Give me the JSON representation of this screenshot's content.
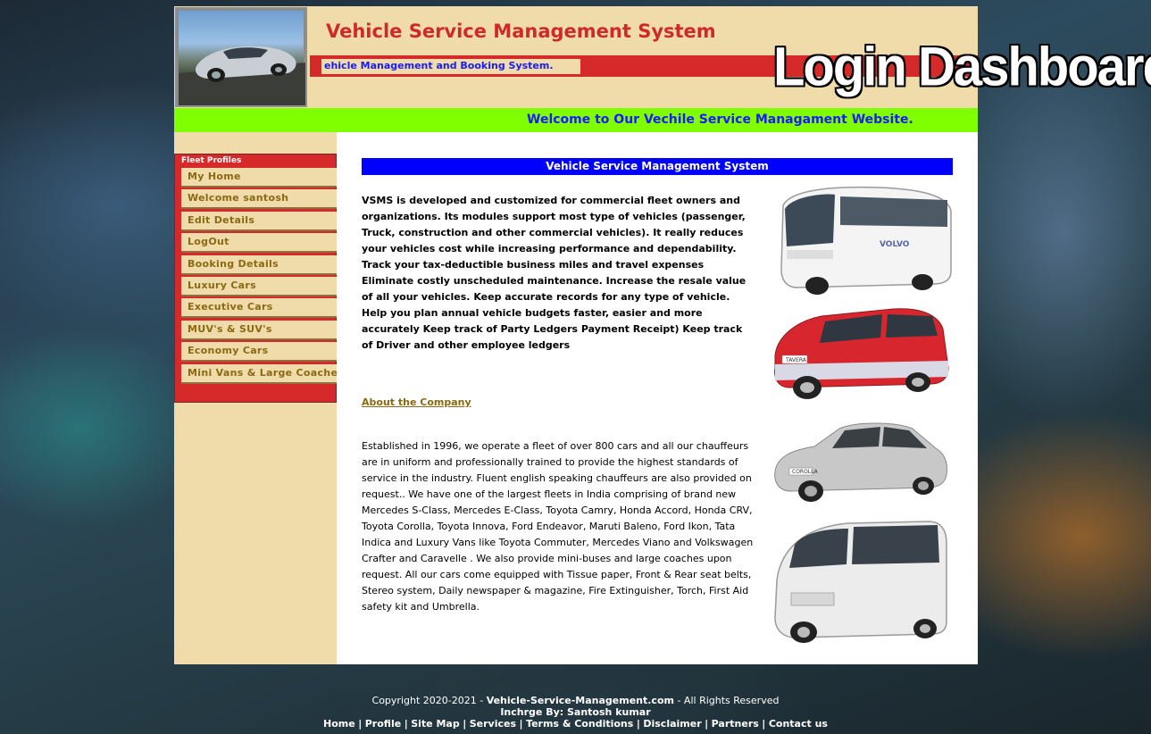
{
  "header": {
    "site_title": "Vehicle Service Management System",
    "tagline": "ehicle Management and Booking System.",
    "page_banner": "Login Dashboard",
    "welcome": "Welcome to Our Vechile Service Managament Website."
  },
  "sidebar": {
    "title": "Fleet Profiles",
    "items": [
      {
        "label": "My Home"
      },
      {
        "label": "Welcome santosh"
      },
      {
        "label": "Edit Details"
      },
      {
        "label": "LogOut"
      },
      {
        "label": "Booking Details"
      },
      {
        "label": "Luxury Cars"
      },
      {
        "label": "Executive Cars"
      },
      {
        "label": "MUV's & SUV's"
      },
      {
        "label": "Economy Cars"
      },
      {
        "label": "Mini Vans & Large Coaches"
      }
    ]
  },
  "main": {
    "section_title": "Vehicle Service Management System",
    "intro": "VSMS is developed and customized for commercial fleet owners and organizations. Its modules support most type of vehicles (passenger, Truck, construction and other commercial vehicles). It really reduces your vehicles cost while increasing performance and dependability. Track your tax-deductible business miles and travel expenses  Eliminate costly unscheduled maintenance.  Increase the resale value of all your vehicles.  Keep accurate records for any type of vehicle.  Help you plan annual vehicle budgets faster, easier and more accurately  Keep track of Party Ledgers Payment Receipt)  Keep track of Driver and other employee ledgers",
    "about_link": "About the Company",
    "company_text": "Established in 1996, we operate a fleet of over 800 cars and all our chauffeurs are in uniform and professionally trained to provide the highest standards of service in the industry. Fluent english speaking chauffeurs are also provided on request.. We have one of the largest fleets in India comprising of brand new Mercedes S-Class, Mercedes E-Class, Toyota Camry, Honda Accord, Honda CRV, Toyota Corolla, Toyota Innova, Ford Endeavor, Maruti Baleno, Ford Ikon, Tata Indica and Luxury Vans like Toyota Commuter, Mercedes Viano and Volkswagen Crafter and Caravelle . We also provide mini-buses and large coaches upon request. All our cars come equipped with Tissue paper, Front & Rear seat belts, Stereo system, Daily newspaper & magazine, Fire Extinguisher, Torch, First Aid safety kit and Umbrella.",
    "bus_label": "VOLVO",
    "suv_label": "TAVERA",
    "car_label": "COROLLA"
  },
  "footer": {
    "copyright_prefix": "Copyright 2020-2021 - ",
    "copyright_site": "Vehicle-Service-Management.com",
    "copyright_suffix": " - All Rights Reserved",
    "incharge": "Inchrge By: Santosh kumar",
    "links": [
      "Home",
      "Profile",
      "Site Map",
      "Services",
      "Terms & Conditions",
      "Disclaimer",
      "Partners",
      "Contact us"
    ]
  },
  "colors": {
    "header_bg": "#efdcaa",
    "title_red": "#cf2a2a",
    "welcome_green": "#80ff00",
    "section_blue": "#0000ff",
    "menu_text": "#8b6914"
  }
}
